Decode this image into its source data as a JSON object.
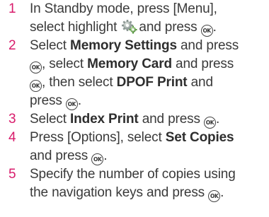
{
  "steps": [
    {
      "number": "1",
      "lines": [
        [
          "In Standby mode, press [Menu],"
        ],
        [
          "select highlight ",
          "and press "
        ]
      ],
      "icons": {
        "settings": "settings-gears-icon",
        "ok": "ok-button-icon"
      }
    },
    {
      "number": "2",
      "lines": [
        [
          "Select ",
          "Memory Settings",
          " and press"
        ],
        [
          ", select ",
          "Memory Card",
          " and press"
        ],
        [
          ", then select ",
          "DPOF Print",
          " and"
        ],
        [
          "press ",
          "."
        ]
      ]
    },
    {
      "number": "3",
      "lines": [
        [
          "Select ",
          "Index Print",
          " and press ",
          "."
        ]
      ]
    },
    {
      "number": "4",
      "lines": [
        [
          "Press [Options], select ",
          "Set Copies"
        ],
        [
          "and press ",
          "."
        ]
      ]
    },
    {
      "number": "5",
      "lines": [
        [
          "Specify the number of copies using"
        ],
        [
          "the navigation keys and press ",
          "."
        ]
      ]
    }
  ],
  "ok_symbol": "OK",
  "colors": {
    "step_number": "#d81b6b",
    "text": "#3a3a3a"
  }
}
